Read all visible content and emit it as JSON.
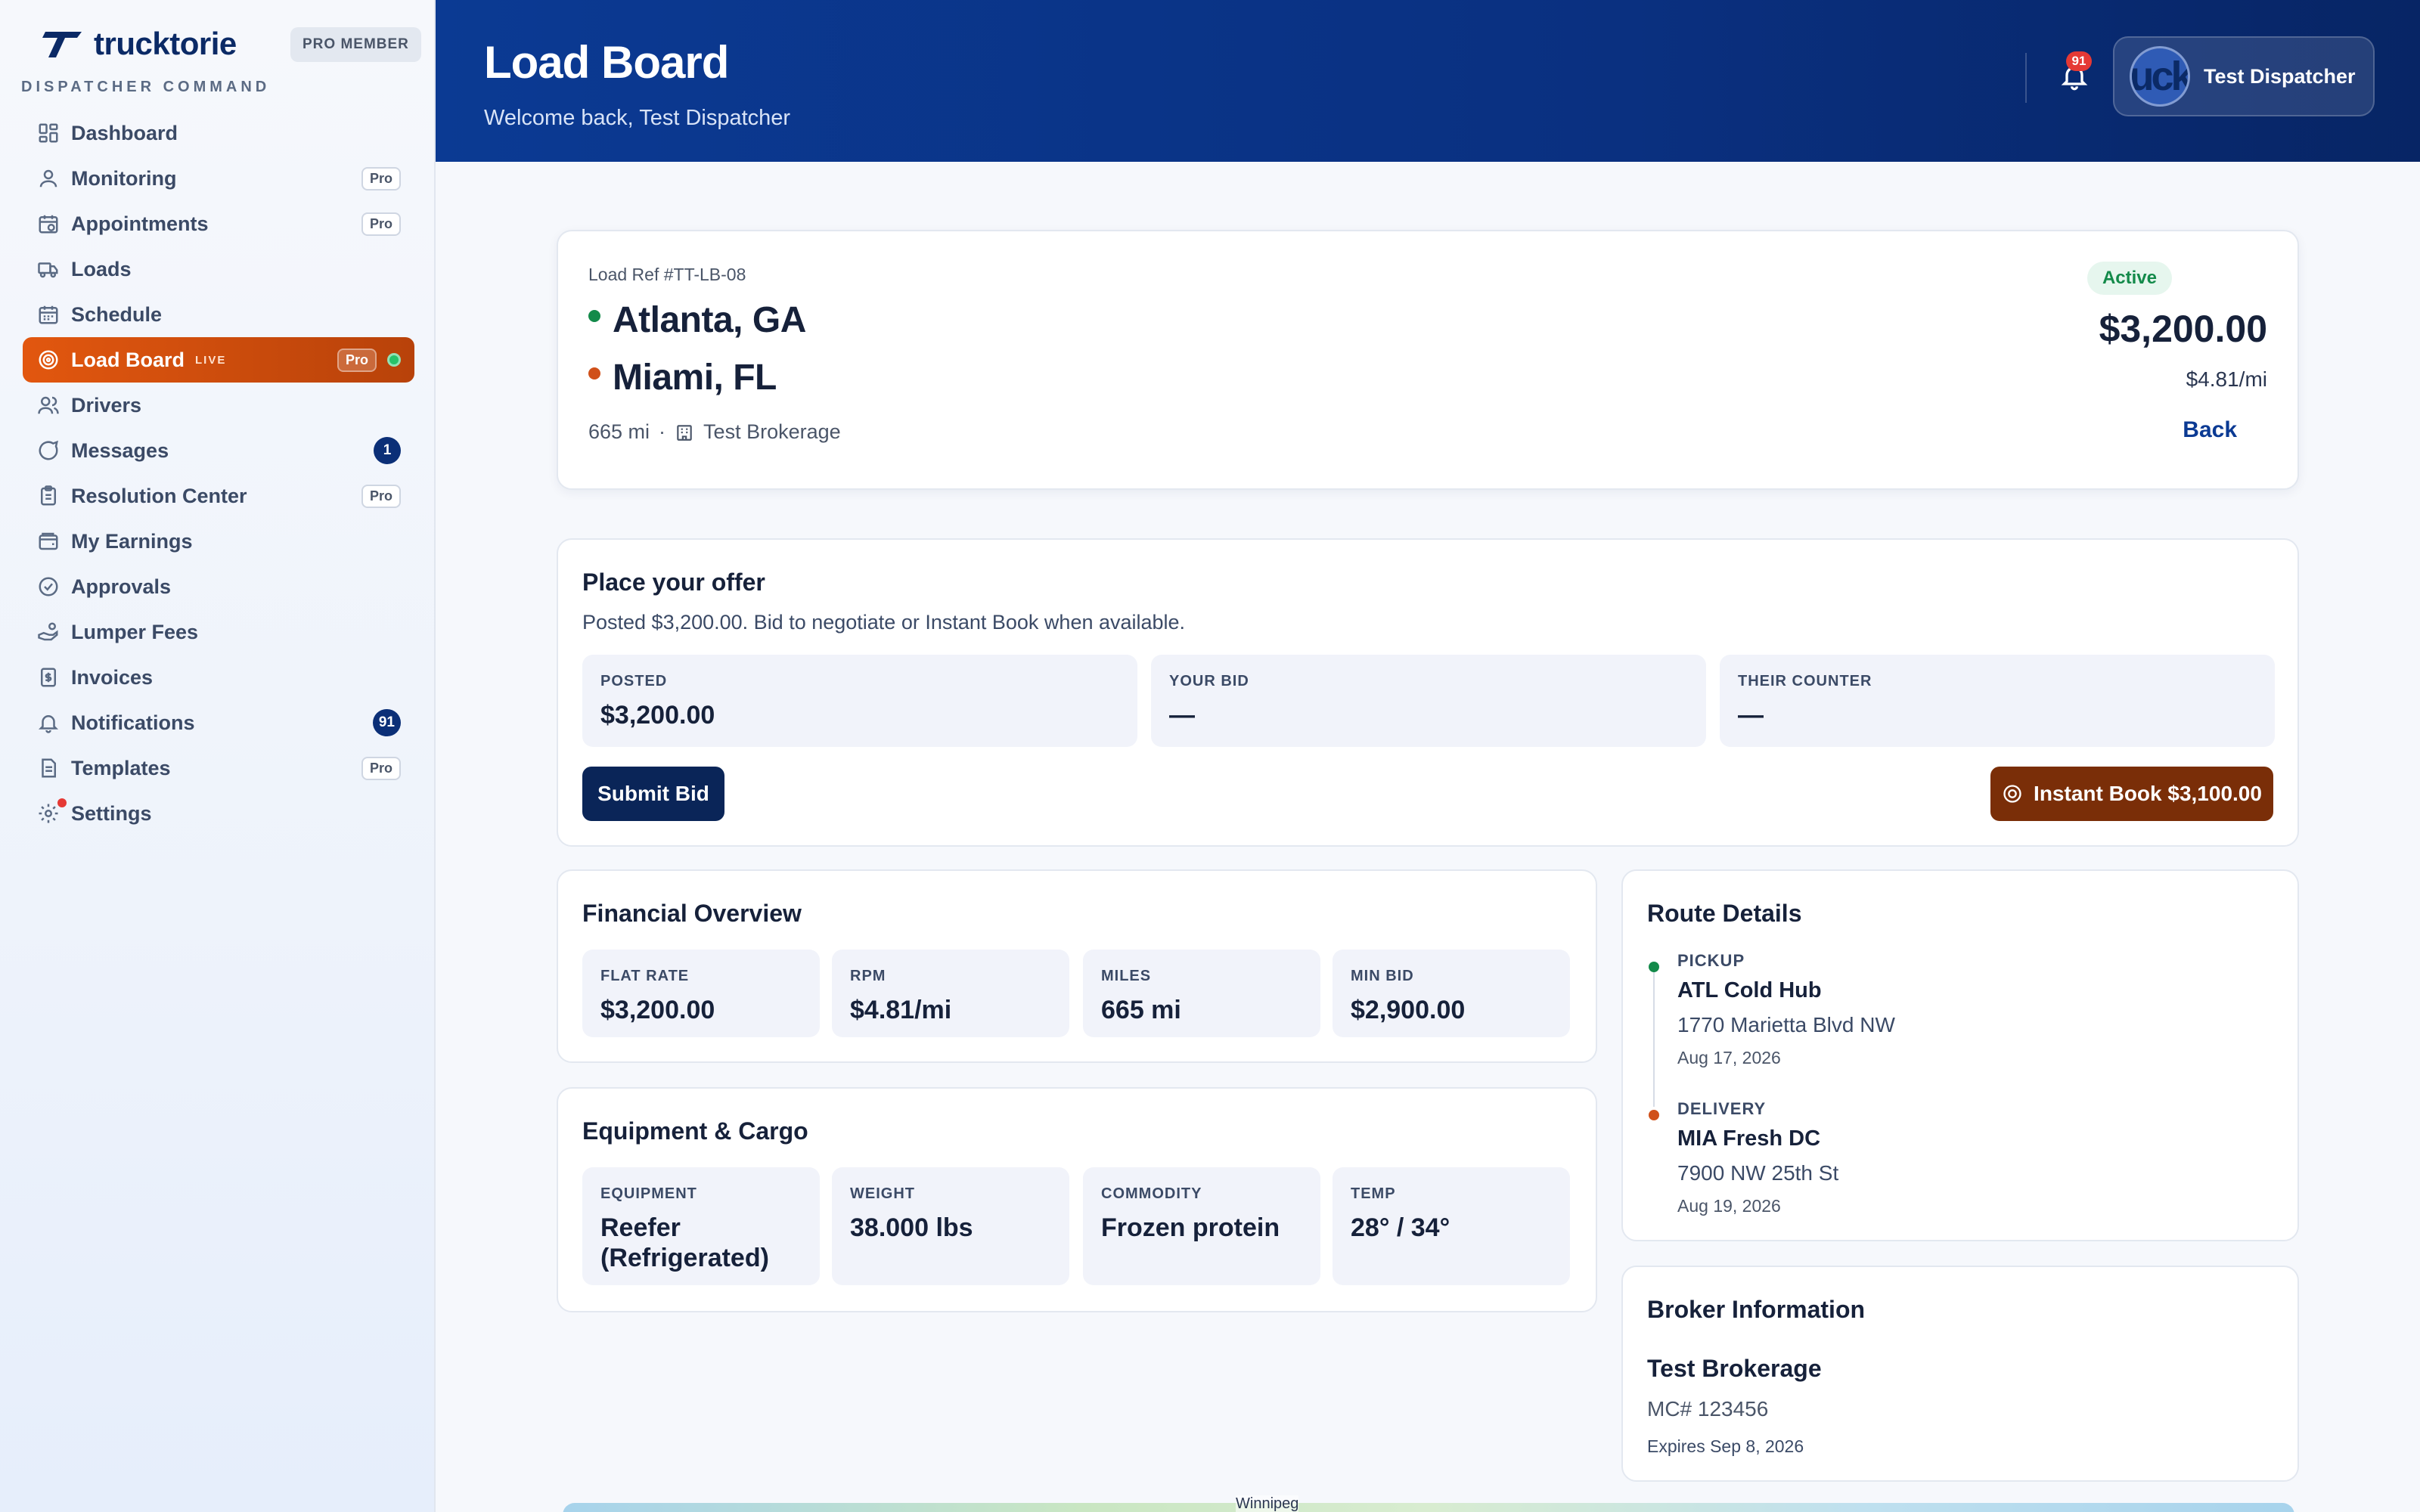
{
  "brand": {
    "name": "trucktorie",
    "badge": "PRO MEMBER",
    "subtitle": "DISPATCHER COMMAND"
  },
  "nav": {
    "items": [
      {
        "label": "Dashboard",
        "icon": "grid-icon"
      },
      {
        "label": "Monitoring",
        "icon": "user-monitor-icon",
        "tag": "Pro"
      },
      {
        "label": "Appointments",
        "icon": "calendar-clock-icon",
        "tag": "Pro"
      },
      {
        "label": "Loads",
        "icon": "truck-icon"
      },
      {
        "label": "Schedule",
        "icon": "calendar-icon"
      },
      {
        "label": "Load Board",
        "icon": "target-icon",
        "live": "LIVE",
        "tag": "Pro",
        "active": true
      },
      {
        "label": "Drivers",
        "icon": "users-icon"
      },
      {
        "label": "Messages",
        "icon": "chat-icon",
        "count": "1"
      },
      {
        "label": "Resolution Center",
        "icon": "clipboard-icon",
        "tag": "Pro"
      },
      {
        "label": "My Earnings",
        "icon": "wallet-icon"
      },
      {
        "label": "Approvals",
        "icon": "check-circle-icon"
      },
      {
        "label": "Lumper Fees",
        "icon": "hand-coins-icon"
      },
      {
        "label": "Invoices",
        "icon": "invoice-icon"
      },
      {
        "label": "Notifications",
        "icon": "bell-icon",
        "count": "91"
      },
      {
        "label": "Templates",
        "icon": "document-icon",
        "tag": "Pro"
      },
      {
        "label": "Settings",
        "icon": "gear-icon"
      }
    ]
  },
  "header": {
    "title": "Load Board",
    "subtitle": "Welcome back, Test Dispatcher",
    "notification_count": "91",
    "user_name": "Test Dispatcher",
    "avatar_text": "uck"
  },
  "load": {
    "ref": "Load Ref #TT-LB-08",
    "origin": "Atlanta, GA",
    "destination": "Miami, FL",
    "miles": "665 mi",
    "separator": "·",
    "brokerage": "Test Brokerage",
    "status": "Active",
    "price": "$3,200.00",
    "rpm": "$4.81/mi",
    "back": "Back"
  },
  "offer": {
    "title": "Place your offer",
    "description": "Posted $3,200.00. Bid to negotiate or Instant Book when available.",
    "posted_label": "POSTED",
    "posted_value": "$3,200.00",
    "your_bid_label": "YOUR BID",
    "your_bid_value": "—",
    "counter_label": "THEIR COUNTER",
    "counter_value": "—",
    "submit": "Submit Bid",
    "instant": "Instant Book $3,100.00"
  },
  "financial": {
    "title": "Financial Overview",
    "stats": [
      {
        "label": "FLAT RATE",
        "value": "$3,200.00"
      },
      {
        "label": "RPM",
        "value": "$4.81/mi"
      },
      {
        "label": "MILES",
        "value": "665 mi"
      },
      {
        "label": "MIN BID",
        "value": "$2,900.00"
      }
    ]
  },
  "equipment": {
    "title": "Equipment & Cargo",
    "stats": [
      {
        "label": "EQUIPMENT",
        "value": "Reefer (Refrigerated)"
      },
      {
        "label": "WEIGHT",
        "value": "38.000 lbs"
      },
      {
        "label": "COMMODITY",
        "value": "Frozen protein"
      },
      {
        "label": "TEMP",
        "value": "28° / 34°"
      }
    ]
  },
  "route": {
    "title": "Route Details",
    "pickup": {
      "label": "PICKUP",
      "name": "ATL Cold Hub",
      "address": "1770 Marietta Blvd NW",
      "date": "Aug 17, 2026"
    },
    "delivery": {
      "label": "DELIVERY",
      "name": "MIA Fresh DC",
      "address": "7900 NW 25th St",
      "date": "Aug 19, 2026"
    }
  },
  "broker": {
    "title": "Broker Information",
    "name": "Test Brokerage",
    "mc": "MC# 123456",
    "expires": "Expires Sep 8, 2026"
  },
  "map": {
    "label": "Winnipeg"
  },
  "colors": {
    "primary": "#0b3a93",
    "active_nav": "#e2570f",
    "instant_book": "#7a2e08",
    "submit": "#0a2558",
    "origin_dot": "#138a4a",
    "destination_dot": "#d0501a"
  }
}
